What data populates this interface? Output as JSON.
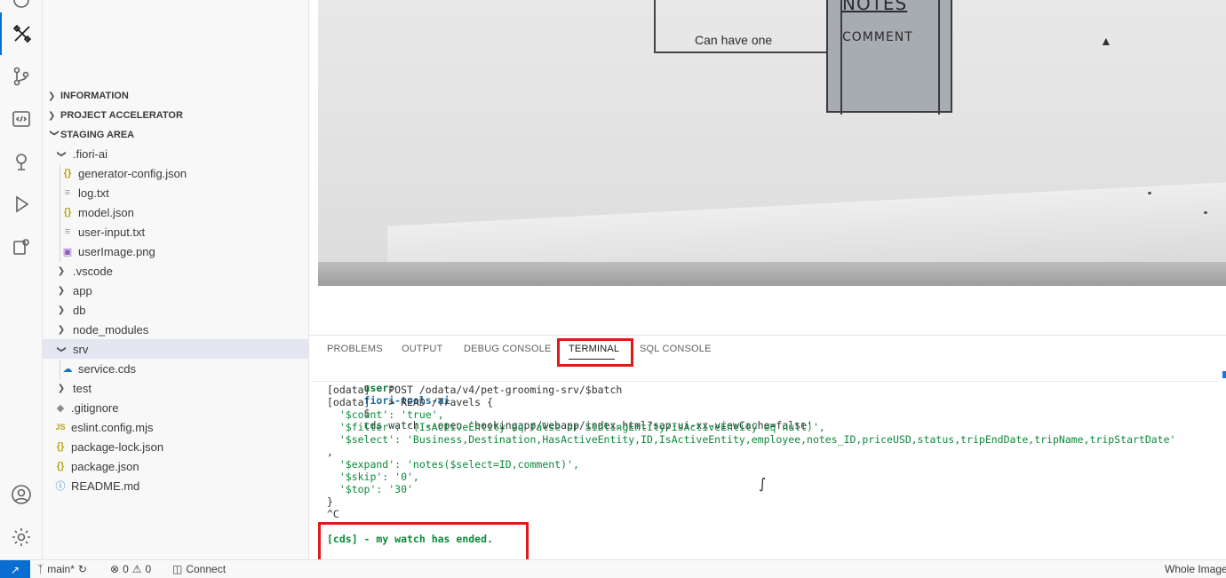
{
  "explorer": {
    "sections": [
      {
        "label": "INFORMATION",
        "expanded": false
      },
      {
        "label": "PROJECT ACCELERATOR",
        "expanded": false
      },
      {
        "label": "STAGING AREA",
        "expanded": true
      }
    ],
    "tree": [
      {
        "label": ".fiori-ai",
        "type": "folder",
        "expanded": true
      },
      {
        "label": "generator-config.json",
        "type": "json"
      },
      {
        "label": "log.txt",
        "type": "txt"
      },
      {
        "label": "model.json",
        "type": "json"
      },
      {
        "label": "user-input.txt",
        "type": "txt"
      },
      {
        "label": "userImage.png",
        "type": "image"
      },
      {
        "label": ".vscode",
        "type": "folder",
        "expanded": false
      },
      {
        "label": "app",
        "type": "folder",
        "expanded": false
      },
      {
        "label": "db",
        "type": "folder",
        "expanded": false
      },
      {
        "label": "node_modules",
        "type": "folder",
        "expanded": false
      },
      {
        "label": "srv",
        "type": "folder",
        "expanded": true,
        "selected": true
      },
      {
        "label": "service.cds",
        "type": "cds"
      },
      {
        "label": "test",
        "type": "folder",
        "expanded": false
      },
      {
        "label": ".gitignore",
        "type": "git"
      },
      {
        "label": "eslint.config.mjs",
        "type": "js"
      },
      {
        "label": "package-lock.json",
        "type": "json"
      },
      {
        "label": "package.json",
        "type": "json"
      },
      {
        "label": "README.md",
        "type": "info"
      }
    ]
  },
  "image": {
    "entity_title": "NOTES",
    "entity_field": "COMMENT",
    "connector_label": "Can have one"
  },
  "panel": {
    "tabs": [
      "PROBLEMS",
      "OUTPUT",
      "DEBUG CONSOLE",
      "TERMINAL",
      "SQL CONSOLE"
    ],
    "active_tab": "TERMINAL",
    "prompt_user": "user:",
    "prompt_dir": "fiori-tools-ai",
    "prompt_symbol": "$",
    "command": "cds watch --open 'bookingapp/webapp/index.html?sap-ui-xx-viewCache=false'",
    "lines": [
      "[odata] - POST /odata/v4/pet-grooming-srv/$batch",
      "[odata] - > READ /Travels {",
      "  '$count': 'true',",
      "  '$filter': '(IsActiveEntity eq false or SiblingEntity/IsActiveEntity eq null)',",
      "  '$select': 'Business,Destination,HasActiveEntity,ID,IsActiveEntity,employee,notes_ID,priceUSD,status,tripEndDate,tripName,tripStartDate'",
      ",",
      "  '$expand': 'notes($select=ID,comment)',",
      "  '$skip': '0',",
      "  '$top': '30'",
      "}",
      "^C"
    ],
    "ended_message": "[cds] - my watch has ended."
  },
  "statusbar": {
    "branch": "main*",
    "errors": "0",
    "warnings": "0",
    "connect": "Connect",
    "right_text": "Whole Image"
  },
  "colors": {
    "accent": "#0a6ed1",
    "highlight": "#e01919",
    "prompt_green": "#0a7c3a",
    "prompt_blue": "#1b6ea8"
  }
}
